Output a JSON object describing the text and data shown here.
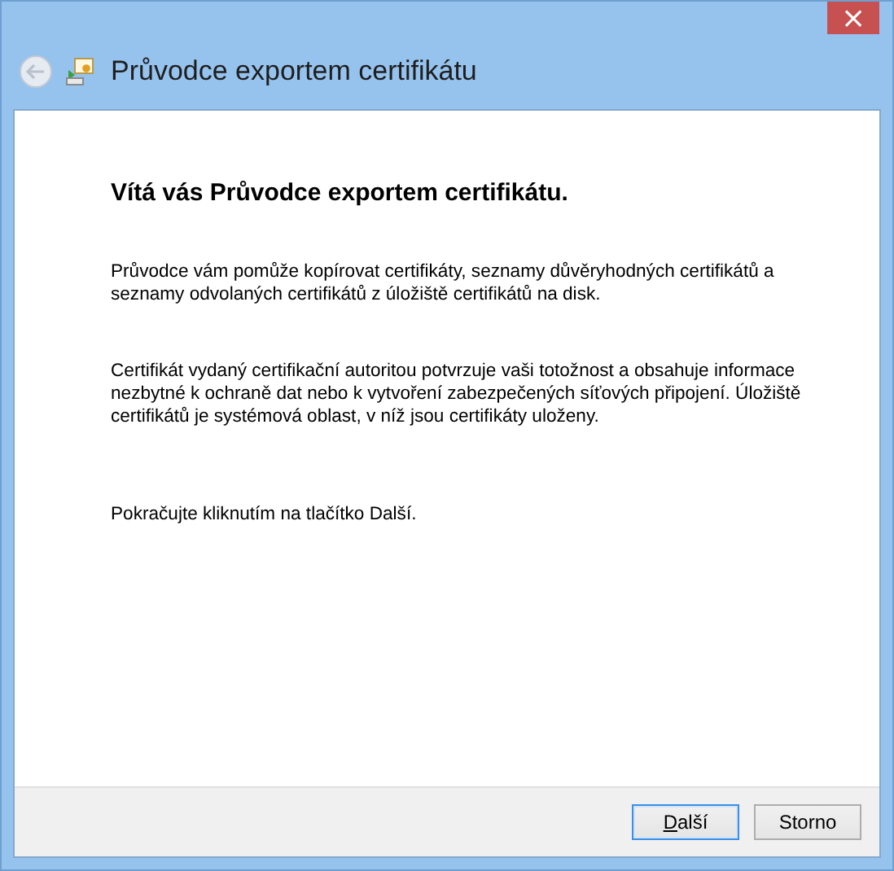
{
  "window": {
    "close": "×",
    "title": "Průvodce exportem certifikátu",
    "back_disabled": true
  },
  "heading": "Vítá vás Průvodce exportem certifikátu.",
  "paragraphs": [
    "Průvodce vám pomůže kopírovat certifikáty, seznamy důvěryhodných certifikátů a seznamy odvolaných certifikátů z úložiště certifikátů na disk.",
    "Certifikát vydaný certifikační autoritou potvrzuje vaši totožnost a obsahuje informace nezbytné k ochraně dat nebo k vytvoření zabezpečených síťových připojení. Úložiště certifikátů je systémová oblast, v níž jsou certifikáty uloženy.",
    "Pokračujte kliknutím na tlačítko Další."
  ],
  "buttons": [
    {
      "label": "Další",
      "default": true
    },
    {
      "label": "Storno",
      "default": false
    }
  ]
}
